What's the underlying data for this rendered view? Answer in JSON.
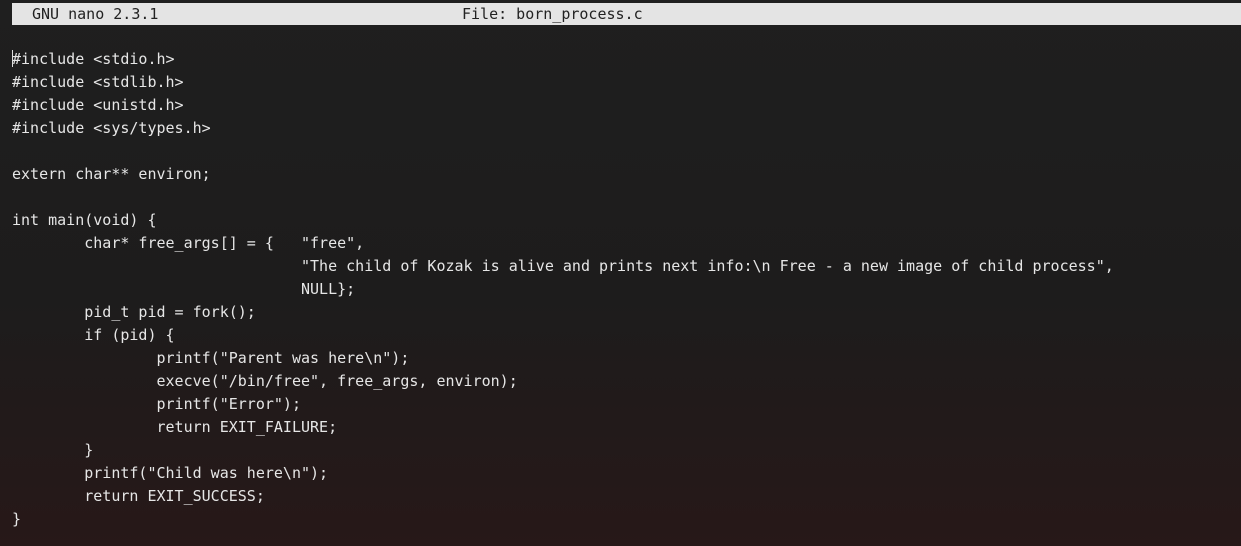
{
  "titlebar": {
    "app": "GNU nano 2.3.1",
    "file": "File: born_process.c"
  },
  "editor": {
    "lines": [
      "#include <stdio.h>",
      "#include <stdlib.h>",
      "#include <unistd.h>",
      "#include <sys/types.h>",
      "",
      "extern char** environ;",
      "",
      "int main(void) {",
      "        char* free_args[] = {   \"free\",",
      "                                \"The child of Kozak is alive and prints next info:\\n Free - a new image of child process\",",
      "                                NULL};",
      "        pid_t pid = fork();",
      "        if (pid) {",
      "                printf(\"Parent was here\\n\");",
      "                execve(\"/bin/free\", free_args, environ);",
      "                printf(\"Error\");",
      "                return EXIT_FAILURE;",
      "        }",
      "        printf(\"Child was here\\n\");",
      "        return EXIT_SUCCESS;",
      "}"
    ]
  }
}
